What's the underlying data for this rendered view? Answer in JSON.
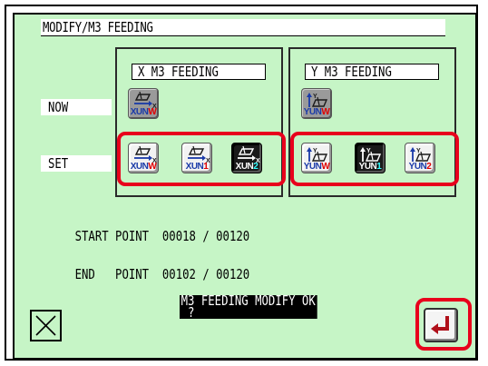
{
  "title": "MODIFY/M3 FEEDING",
  "x_panel": {
    "title": "X M3 FEEDING",
    "now": {
      "icon": "xun-w-icon",
      "code_main": "XUN",
      "code_suffix": "W"
    },
    "set": [
      {
        "icon": "xun-w-icon",
        "code_main": "XUN",
        "code_suffix": "W",
        "selected": false
      },
      {
        "icon": "xun-1-icon",
        "code_main": "XUN",
        "code_suffix": "1",
        "selected": false
      },
      {
        "icon": "xun-2-icon",
        "code_main": "XUN",
        "code_suffix": "2",
        "selected": true
      }
    ]
  },
  "y_panel": {
    "title": "Y M3 FEEDING",
    "now": {
      "icon": "yun-w-icon",
      "code_main": "YUN",
      "code_suffix": "W"
    },
    "set": [
      {
        "icon": "yun-w-icon",
        "code_main": "YUN",
        "code_suffix": "W",
        "selected": false
      },
      {
        "icon": "yun-1-icon",
        "code_main": "YUN",
        "code_suffix": "1",
        "selected": true
      },
      {
        "icon": "yun-2-icon",
        "code_main": "YUN",
        "code_suffix": "2",
        "selected": false
      }
    ]
  },
  "labels": {
    "now": "NOW",
    "set": "SET"
  },
  "start_point": {
    "label": "START POINT",
    "value": "00018 / 00120"
  },
  "end_point": {
    "label": "END   POINT",
    "value": "00102 / 00120"
  },
  "message": {
    "line1": "M3 FEEDING MODIFY OK",
    "line2": " ?"
  },
  "colors": {
    "background": "#c6f5c6",
    "highlight": "#e8001c",
    "icon_blue": "#1a3aa8",
    "icon_red": "#e00000",
    "icon_cyan": "#33ffff"
  },
  "buttons": {
    "cancel_icon": "close-icon",
    "enter_icon": "enter-return-icon"
  }
}
